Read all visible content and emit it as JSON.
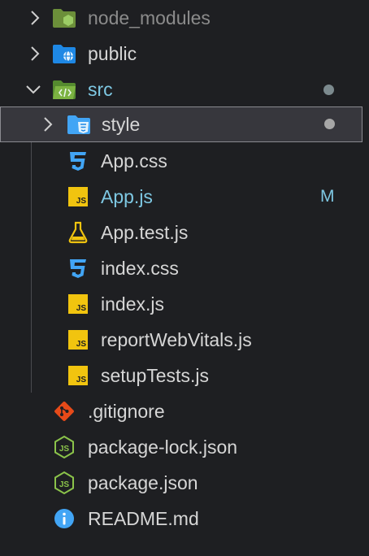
{
  "explorer": {
    "items": [
      {
        "id": "node_modules",
        "label": "node_modules",
        "type": "folder",
        "state": "collapsed",
        "icon": "node-modules-folder-icon",
        "dimmed": true
      },
      {
        "id": "public",
        "label": "public",
        "type": "folder",
        "state": "collapsed",
        "icon": "public-folder-icon"
      },
      {
        "id": "src",
        "label": "src",
        "type": "folder",
        "state": "expanded",
        "icon": "src-folder-icon",
        "indicator": "dot"
      },
      {
        "id": "style",
        "label": "style",
        "type": "folder",
        "state": "collapsed",
        "icon": "style-folder-icon",
        "indicator": "dot",
        "selected": true
      },
      {
        "id": "app_css",
        "label": "App.css",
        "type": "file",
        "icon": "css-icon"
      },
      {
        "id": "app_js",
        "label": "App.js",
        "type": "file",
        "icon": "js-icon",
        "status": "M"
      },
      {
        "id": "app_test",
        "label": "App.test.js",
        "type": "file",
        "icon": "test-flask-icon"
      },
      {
        "id": "index_css",
        "label": "index.css",
        "type": "file",
        "icon": "css-icon"
      },
      {
        "id": "index_js",
        "label": "index.js",
        "type": "file",
        "icon": "js-icon"
      },
      {
        "id": "report",
        "label": "reportWebVitals.js",
        "type": "file",
        "icon": "js-icon"
      },
      {
        "id": "setup",
        "label": "setupTests.js",
        "type": "file",
        "icon": "js-icon"
      },
      {
        "id": "gitignore",
        "label": ".gitignore",
        "type": "file",
        "icon": "git-icon"
      },
      {
        "id": "pkglock",
        "label": "package-lock.json",
        "type": "file",
        "icon": "nodejs-icon"
      },
      {
        "id": "pkg",
        "label": "package.json",
        "type": "file",
        "icon": "nodejs-icon"
      },
      {
        "id": "readme",
        "label": "README.md",
        "type": "file",
        "icon": "info-icon"
      }
    ]
  },
  "colors": {
    "background": "#1e1f22",
    "selected_row": "#37373d",
    "text": "#d6d6d6",
    "modified_text": "#7ec8e3",
    "js_yellow": "#f1c40f",
    "css_blue": "#42a5f5",
    "folder_green": "#7cb342",
    "git_orange": "#e64a19",
    "node_green": "#8bc34a"
  }
}
